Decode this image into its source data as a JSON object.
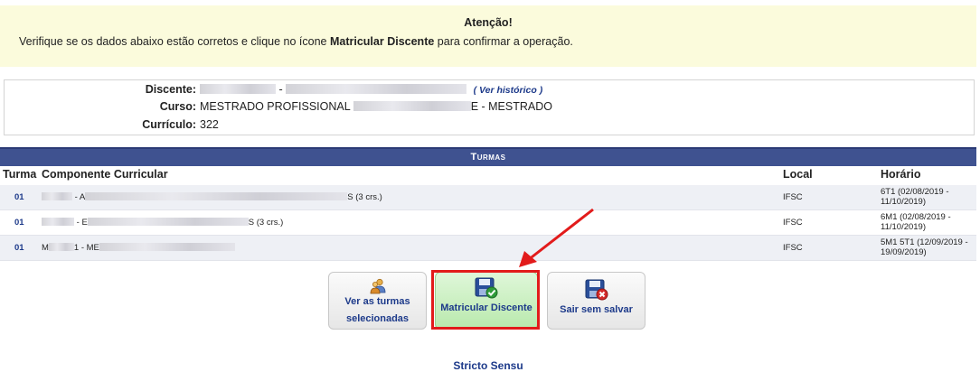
{
  "alert": {
    "title": "Atenção!",
    "message_before": "Verifique se os dados abaixo estão corretos e clique no ícone ",
    "message_bold": "Matricular Discente",
    "message_after": " para confirmar a operação."
  },
  "student": {
    "discente_label": "Discente:",
    "discente_sep": " - ",
    "ver_historico": "( Ver histórico )",
    "curso_label": "Curso:",
    "curso_prefix": "MESTRADO PROFISSIONAL ",
    "curso_suffix": "E - MESTRADO",
    "curriculo_label": "Currículo:",
    "curriculo_value": "322"
  },
  "turmas": {
    "section_title": "Turmas",
    "columns": {
      "turma": "Turma",
      "componente": "Componente Curricular",
      "local": "Local",
      "horario": "Horário"
    },
    "rows": [
      {
        "turma": "01",
        "comp_prefix": "A",
        "comp_suffix": "S (3 crs.)",
        "local": "IFSC",
        "horario": "6T1 (02/08/2019 - 11/10/2019)"
      },
      {
        "turma": "01",
        "comp_prefix": "E",
        "comp_suffix": "S (3 crs.)",
        "local": "IFSC",
        "horario": "6M1 (02/08/2019 - 11/10/2019)"
      },
      {
        "turma": "01",
        "comp_prefix": "M",
        "comp_suffix": "1 - ME",
        "local": "IFSC",
        "horario": "5M1 5T1 (12/09/2019 - 19/09/2019)"
      }
    ]
  },
  "buttons": {
    "ver_turmas": "Ver as turmas selecionadas",
    "ver_turmas_line1": "Ver as turmas",
    "ver_turmas_line2": "selecionadas",
    "matricular": "Matricular Discente",
    "sair": "Sair sem salvar"
  },
  "footer": {
    "link": "Stricto Sensu"
  },
  "colors": {
    "alert_bg": "#fbfbdc",
    "header_bg": "#3f5290",
    "link": "#1d3a8a",
    "highlight": "#e21b1b",
    "matricular_bg": "#c8f0be"
  }
}
